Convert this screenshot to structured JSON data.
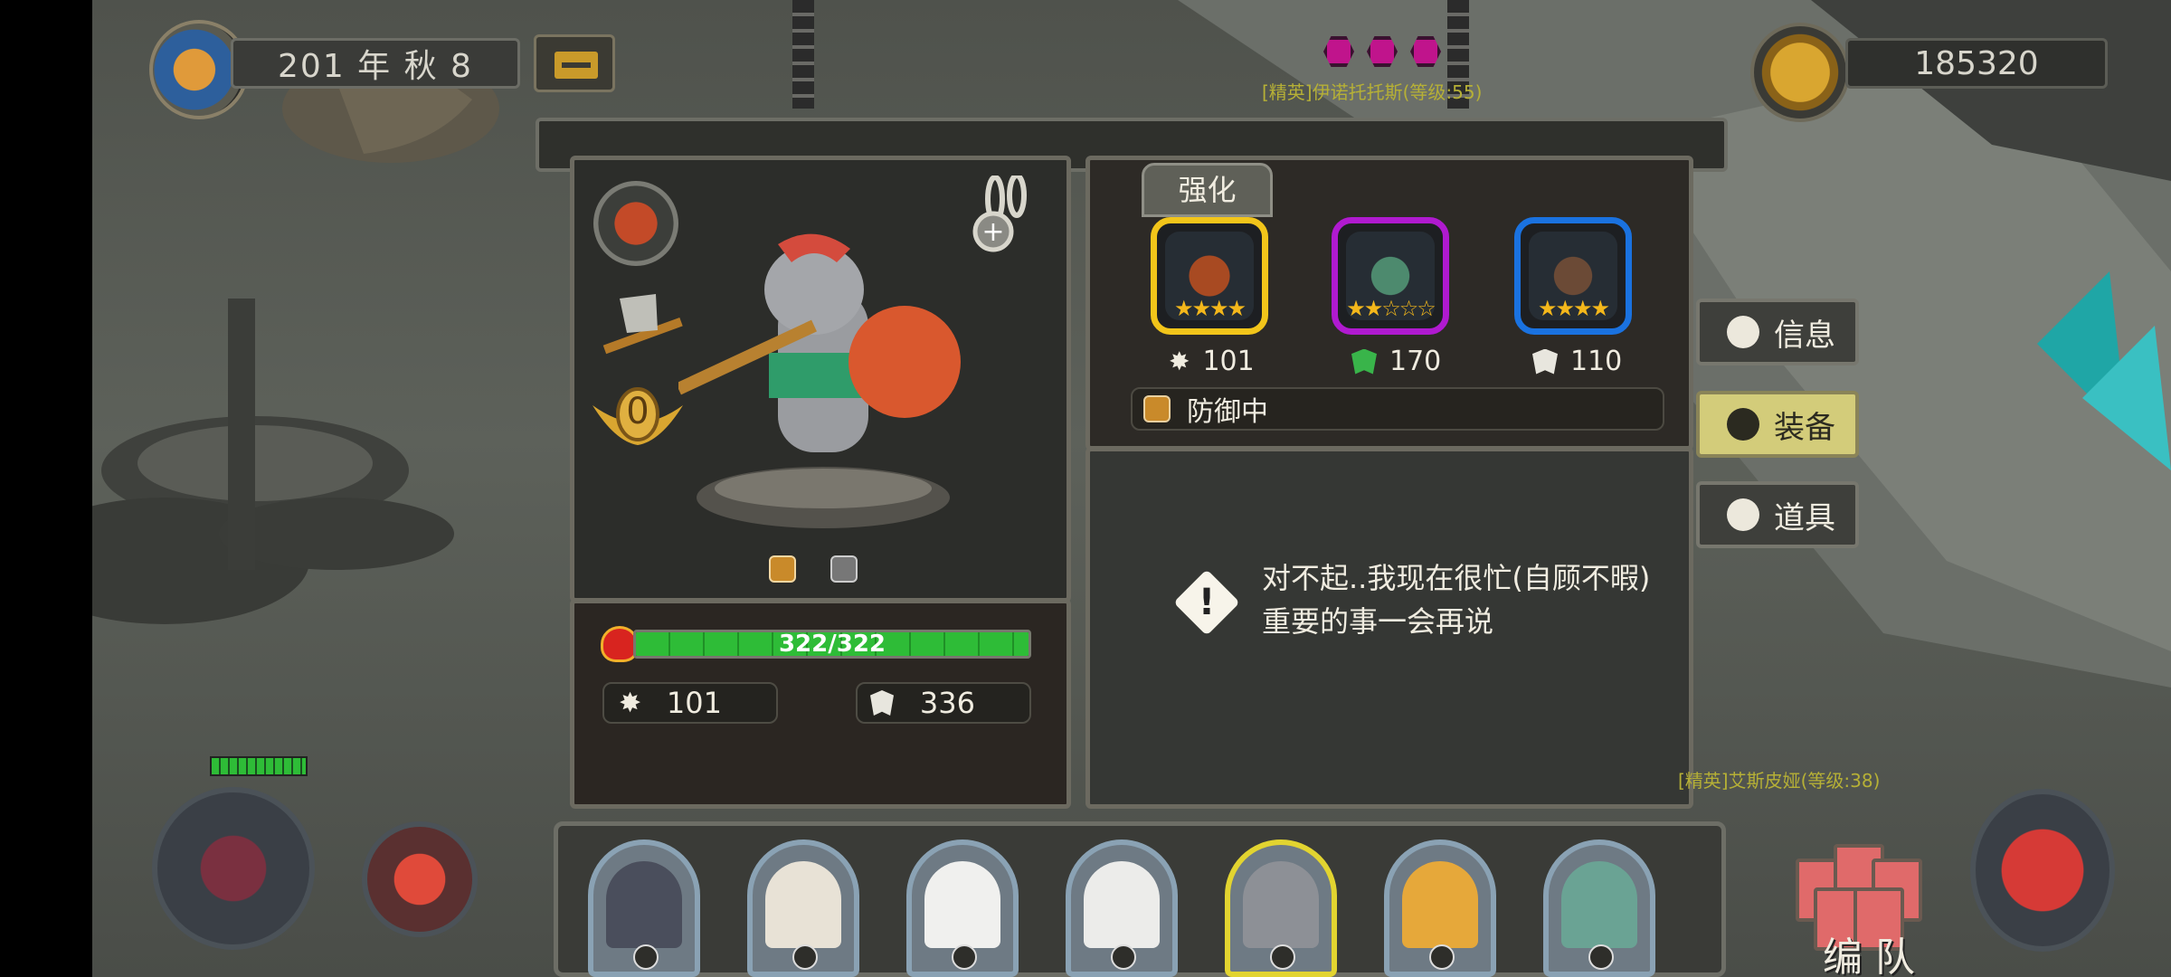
{
  "top_bar": {
    "date_label": "201 年 秋 8",
    "coins": "185320"
  },
  "enemy_tags": {
    "top": "[精英]伊诺托托斯(等级:55)",
    "bottom": "[精英]艾斯皮娅(等级:38)"
  },
  "equipment": {
    "tab_label": "强化",
    "slots": [
      {
        "name": "weapon",
        "rarity_color": "#f2c51a",
        "stars": "★★★★",
        "value": "101",
        "stat_icon": "attack-icon"
      },
      {
        "name": "armor",
        "rarity_color": "#b01ad0",
        "stars": "★★☆☆☆",
        "value": "170",
        "stat_icon": "health-shield-icon"
      },
      {
        "name": "accessory",
        "rarity_color": "#1a72e0",
        "stars": "★★★★",
        "value": "110",
        "stat_icon": "defense-shield-icon"
      }
    ],
    "status": "防御中"
  },
  "message": {
    "text": "对不起..我现在很忙(自顾不暇)重要的事一会再说"
  },
  "character": {
    "level_badge": "0",
    "hp_text": "322/322",
    "hp_fraction": 1.0,
    "attack": "101",
    "defense": "336"
  },
  "side_tabs": [
    {
      "label": "信息",
      "icon": "info-icon",
      "active": false
    },
    {
      "label": "装备",
      "icon": "helmet-icon",
      "active": true
    },
    {
      "label": "道具",
      "icon": "bag-icon",
      "active": false
    }
  ],
  "roster": [
    {
      "hero": "pirate-rhino",
      "color": "#4a4e5c",
      "selected": false
    },
    {
      "hero": "eagle",
      "color": "#e8e2d6",
      "selected": false
    },
    {
      "hero": "sheep",
      "color": "#f0f0ee",
      "selected": false
    },
    {
      "hero": "polar-bear",
      "color": "#ececea",
      "selected": false
    },
    {
      "hero": "elephant",
      "color": "#8d9096",
      "selected": true
    },
    {
      "hero": "leopard",
      "color": "#e6a83a",
      "selected": false
    },
    {
      "hero": "crocodile",
      "color": "#6aa394",
      "selected": false
    }
  ],
  "team_button": {
    "label": "编 队"
  },
  "colors": {
    "hp_green": "#2ebc37",
    "active_tab": "#d3cc7a",
    "gold": "#f3b71b"
  }
}
